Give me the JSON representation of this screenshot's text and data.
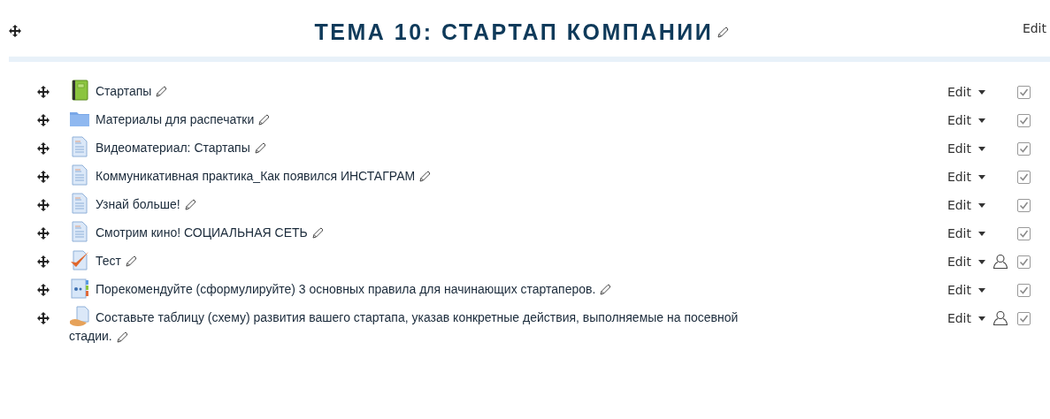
{
  "section": {
    "title": "ТЕМА 10: СТАРТАП КОМПАНИИ",
    "edit_menu": "Edit"
  },
  "activities": [
    {
      "kind": "book",
      "name": "Стартапы",
      "edit_menu": "Edit",
      "restricted": false,
      "checked": true
    },
    {
      "kind": "folder",
      "name": "Материалы для распечатки",
      "edit_menu": "Edit",
      "restricted": false,
      "checked": true
    },
    {
      "kind": "page",
      "name": "Видеоматериал: Стартапы",
      "edit_menu": "Edit",
      "restricted": false,
      "checked": true
    },
    {
      "kind": "page",
      "name": "Коммуникативная практика_Как появился ИНСТАГРАМ",
      "edit_menu": "Edit",
      "restricted": false,
      "checked": true
    },
    {
      "kind": "page",
      "name": "Узнай больше!",
      "edit_menu": "Edit",
      "restricted": false,
      "checked": true
    },
    {
      "kind": "page",
      "name": "Смотрим кино! СОЦИАЛЬНАЯ СЕТЬ",
      "edit_menu": "Edit",
      "restricted": false,
      "checked": true
    },
    {
      "kind": "quiz",
      "name": "Тест",
      "edit_menu": "Edit",
      "restricted": true,
      "checked": true
    },
    {
      "kind": "glossary",
      "name": "Порекомендуйте (сформулируйте) 3 основных правила для начинающих стартаперов.",
      "edit_menu": "Edit",
      "restricted": false,
      "checked": true
    },
    {
      "kind": "assignment",
      "name": "Составьте таблицу (схему) развития вашего стартапа, указав конкретные действия, выполняемые на посевной стадии.",
      "edit_menu": "Edit",
      "restricted": true,
      "checked": true
    }
  ]
}
